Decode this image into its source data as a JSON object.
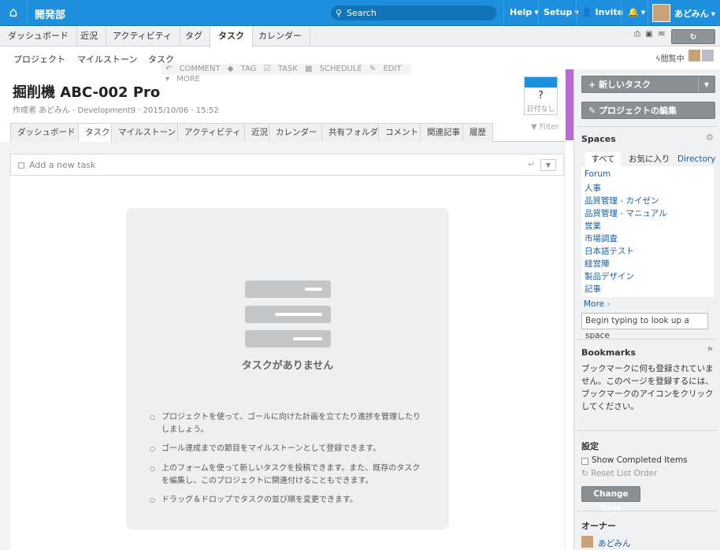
{
  "topbar": {
    "title": "開発部",
    "search_label": "Search",
    "help": "Help",
    "setup": "Setup",
    "invite": "Invite",
    "user": "あどみん"
  },
  "tabs1": [
    "ダッシュボード",
    "近況",
    "アクティビティ",
    "タグ",
    "タスク",
    "カレンダー"
  ],
  "tabs1_active": "タスク",
  "refresh": "Refresh",
  "tabs2": [
    "プロジェクト",
    "マイルストーン",
    "タスク"
  ],
  "actions": [
    "COMMENT",
    "TAG",
    "TASK",
    "SCHEDULE",
    "EDIT",
    "MORE"
  ],
  "viewing": "閲覧中",
  "project": {
    "title": "掘削機 ABC-002 Pro",
    "meta": "作成者 あどみん · Development9 · 2015/10/06 · 15:52",
    "date_q": "?",
    "date_none": "日付なし"
  },
  "tabs3": [
    "ダッシュボード",
    "タスク",
    "マイルストーン",
    "アクティビティ",
    "近況",
    "カレンダー",
    "共有フォルダ",
    "コメント",
    "関連記事",
    "履歴"
  ],
  "tabs3_active": "タスク",
  "filter": "Filter",
  "newtask_placeholder": "Add a new task",
  "empty": {
    "title": "タスクがありません",
    "tips": [
      "プロジェクトを使って、ゴールに向けた計画を立てたり進捗を管理したりしましょう。",
      "ゴール達成までの節目をマイルストーンとして登録できます。",
      "上のフォームを使って新しいタスクを投稿できます。また、既存のタスクを編集し、このプロジェクトに関連付けることもできます。",
      "ドラッグ＆ドロップでタスクの並び順を変更できます。"
    ]
  },
  "sidebar": {
    "new_task": "新しいタスク",
    "edit_project": "プロジェクトの編集",
    "spaces_title": "Spaces",
    "spaces_tabs": [
      "すべて",
      "お気に入り",
      "Directory"
    ],
    "spaces": [
      "Forum",
      "人事",
      "品質管理 - カイゼン",
      "品質管理 - マニュアル",
      "営業",
      "市場調査",
      "日本語テスト",
      "経営陣",
      "製品デザイン",
      "記事"
    ],
    "more": "More",
    "lookup_placeholder": "Begin typing to look up a space",
    "bookmarks_title": "Bookmarks",
    "bookmarks_text": "ブックマークに何も登録されていません。このページを登録するには、ブックマークのアイコンをクリックしてください。",
    "settings_title": "設定",
    "show_completed": "Show Completed Items",
    "reset_order": "Reset List Order",
    "change_tags": "Change Tags",
    "owner_title": "オーナー",
    "owner_name": "あどみん"
  }
}
